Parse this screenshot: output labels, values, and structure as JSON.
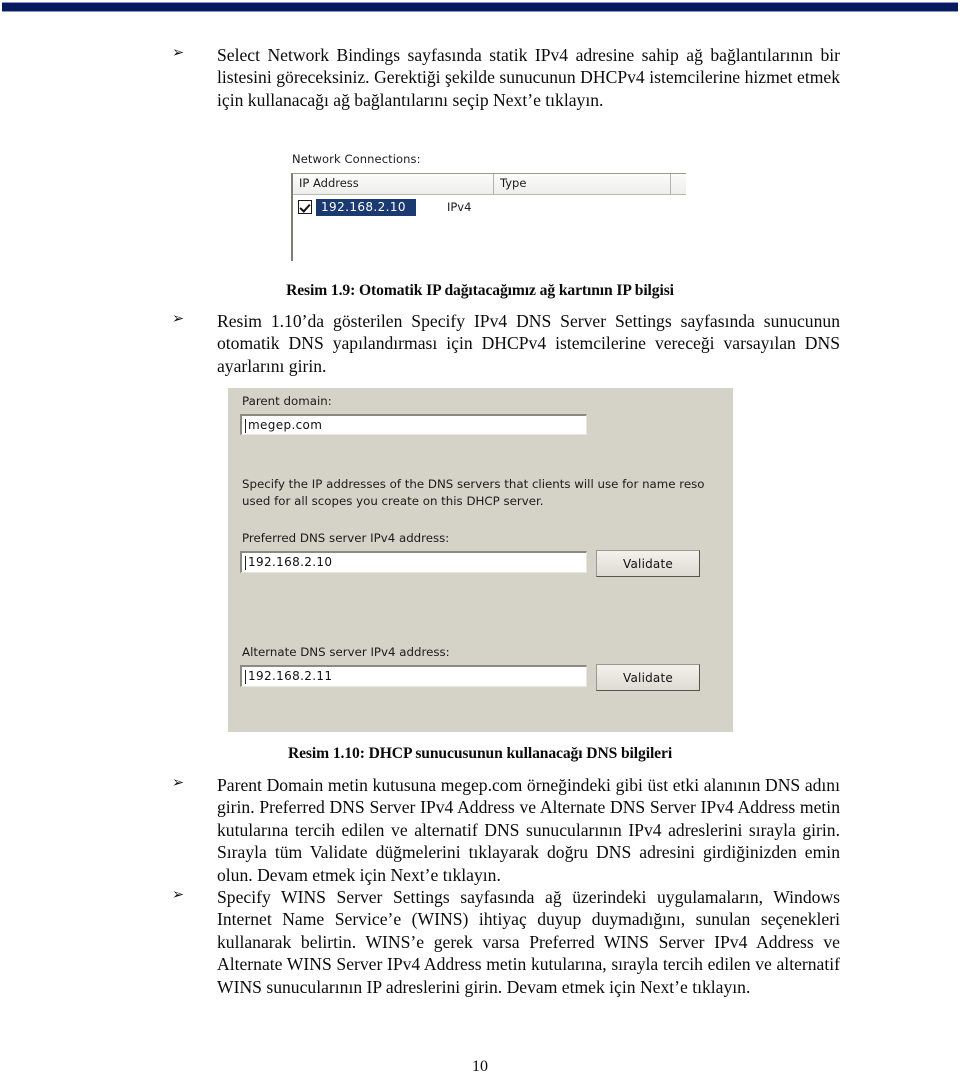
{
  "document": {
    "page_number": "10",
    "top_rule_color": "#081a5e"
  },
  "bullets": [
    {
      "marker": "➢",
      "text": "Select Network Bindings sayfasında statik IPv4 adresine sahip ağ bağlantılarının bir listesini göreceksiniz. Gerektiği şekilde sunucunun DHCPv4 istemcilerine hizmet etmek için kullanacağı ağ bağlantılarını seçip Next’e tıklayın."
    },
    {
      "marker": "➢",
      "text": "Resim 1.10’da gösterilen Specify IPv4 DNS Server Settings sayfasında sunucunun otomatik DNS yapılandırması için DHCPv4 istemcilerine vereceği varsayılan DNS ayarlarını girin."
    },
    {
      "marker": "➢",
      "text": "Parent Domain metin kutusuna megep.com örneğindeki gibi üst etki alanının DNS adını girin. Preferred DNS Server IPv4 Address ve Alternate DNS Server IPv4 Address metin kutularına tercih edilen ve alternatif DNS sunucularının IPv4 adreslerini sırayla girin. Sırayla tüm Validate düğmelerini tıklayarak doğru DNS adresini girdiğinizden emin olun. Devam etmek için Next’e tıklayın."
    },
    {
      "marker": "➢",
      "text": "Specify WINS Server Settings sayfasında ağ üzerindeki uygulamaların, Windows Internet Name Service’e (WINS) ihtiyaç duyup duymadığını, sunulan seçenekleri kullanarak belirtin. WINS’e gerek varsa Preferred WINS Server IPv4 Address ve Alternate WINS Server IPv4 Address metin kutularına, sırayla tercih edilen ve alternatif WINS sunucularının IP adreslerini girin. Devam etmek için Next’e tıklayın."
    }
  ],
  "captions": {
    "figure_1_9": "Resim 1.9: Otomatik IP dağıtacağımız ağ kartının IP bilgisi",
    "figure_1_10": "Resim 1.10: DHCP sunucusunun kullanacağı DNS bilgileri"
  },
  "figure_network_connections": {
    "label": "Network Connections:",
    "columns": [
      "IP Address",
      "Type",
      ""
    ],
    "rows": [
      {
        "checked": true,
        "ip_address": "192.168.2.10",
        "type": "IPv4"
      }
    ],
    "selection_color": "#1b3a72"
  },
  "figure_dns_settings": {
    "parent_domain_label": "Parent domain:",
    "parent_domain_value": "megep.com",
    "description_line_1": "Specify the IP addresses of the DNS servers that clients will use for name reso",
    "description_line_2": "used for all scopes you create on this DHCP server.",
    "preferred_label": "Preferred DNS server IPv4 address:",
    "preferred_value": "192.168.2.10",
    "preferred_validate_label": "Validate",
    "alternate_label": "Alternate DNS server IPv4 address:",
    "alternate_value": "192.168.2.11",
    "alternate_validate_label": "Validate",
    "background_color": "#d5d2c8"
  }
}
